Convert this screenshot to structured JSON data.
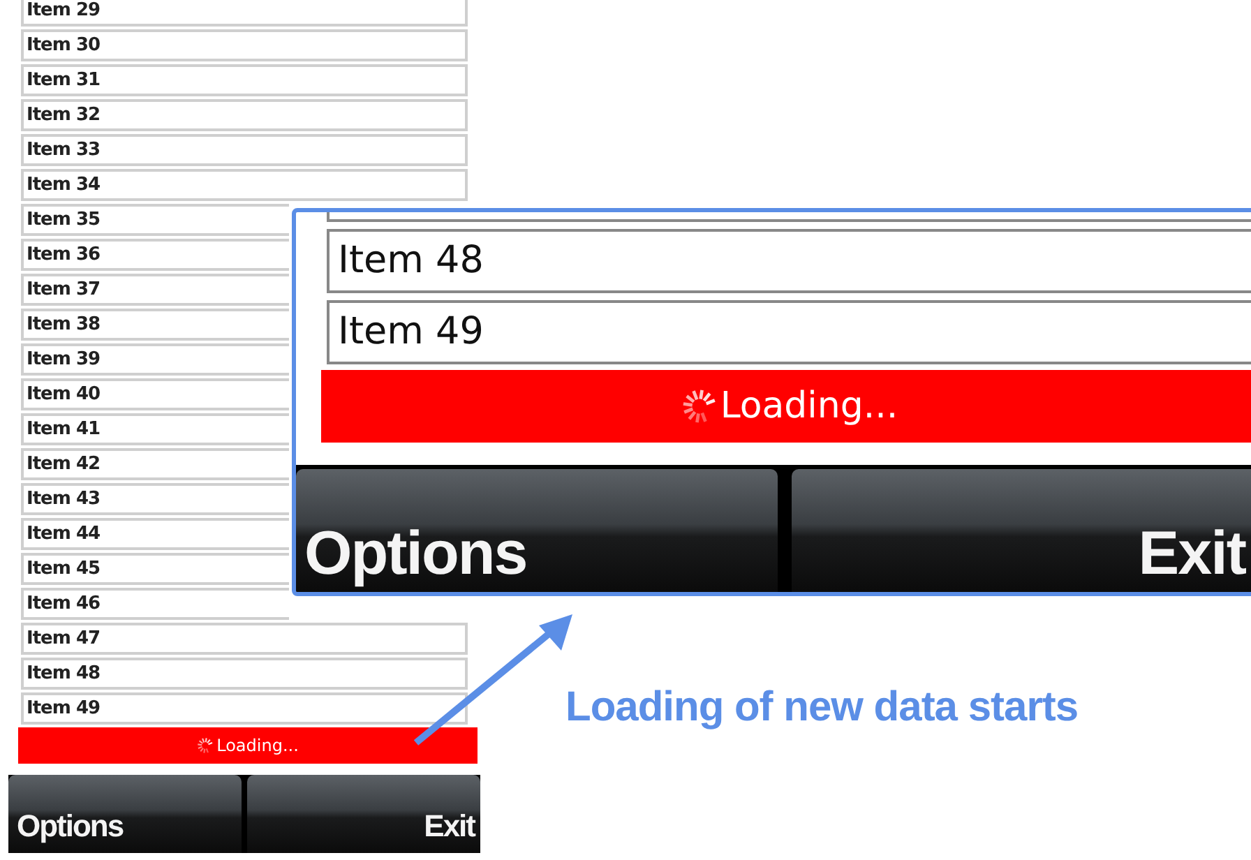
{
  "phone": {
    "list": {
      "items": [
        "Item 29",
        "Item 30",
        "Item 31",
        "Item 32",
        "Item 33",
        "Item 34",
        "Item 35",
        "Item 36",
        "Item 37",
        "Item 38",
        "Item 39",
        "Item 40",
        "Item 41",
        "Item 42",
        "Item 43",
        "Item 44",
        "Item 45",
        "Item 46",
        "Item 47",
        "Item 48",
        "Item 49"
      ]
    },
    "loading": "Loading...",
    "softkeys": [
      "Options",
      "Exit"
    ]
  },
  "zoom_inset": {
    "items": [
      "Item 48",
      "Item 49"
    ],
    "loading": "Loading...",
    "softkeys": [
      "Options",
      "Exit"
    ]
  },
  "callout": {
    "caption": "Loading of new data starts"
  }
}
